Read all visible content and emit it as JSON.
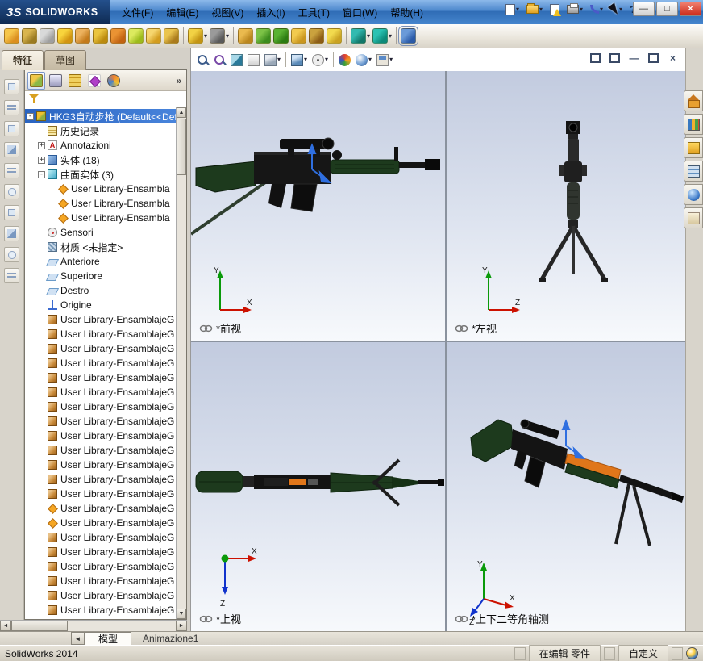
{
  "window": {
    "logo_prefix": "3S",
    "brand": "SOLIDWORKS",
    "buttons": {
      "minimize": "—",
      "maximize": "□",
      "close": "×"
    }
  },
  "menus": [
    "文件(F)",
    "编辑(E)",
    "视图(V)",
    "插入(I)",
    "工具(T)",
    "窗口(W)",
    "帮助(H)"
  ],
  "titlebar_tools": [
    {
      "name": "new-document-icon",
      "type": "page",
      "caret": "▾"
    },
    {
      "name": "open-document-icon",
      "type": "folder",
      "caret": "▾"
    },
    {
      "name": "save-document-icon",
      "type": "save"
    },
    {
      "name": "print-document-icon",
      "type": "printer",
      "caret": "▾"
    },
    {
      "name": "undo-icon",
      "type": "undo",
      "caret": "▾"
    },
    {
      "name": "select-cursor-icon",
      "type": "cursor",
      "caret": "▾"
    },
    {
      "name": "help-button",
      "type": "txt",
      "glyph": "?"
    }
  ],
  "toolbar_icons": [
    {
      "name": "folder-gold-icon",
      "c1": "#f6c64a",
      "c2": "#db8f1f"
    },
    {
      "name": "move-cross-icon",
      "c1": "#d9b54e",
      "c2": "#9b7b22"
    },
    {
      "name": "gray-box-icon",
      "c1": "#d9d9d9",
      "c2": "#9f9f9f"
    },
    {
      "name": "bell-icon",
      "c1": "#f8d43c",
      "c2": "#d29411"
    },
    {
      "name": "envelope-icon",
      "c1": "#ecb25e",
      "c2": "#c37a1b"
    },
    {
      "name": "crate-icon",
      "c1": "#eac43e",
      "c2": "#bb8a0e"
    },
    {
      "name": "notebook-icon",
      "c1": "#ea9333",
      "c2": "#c26312"
    },
    {
      "name": "page-green-icon",
      "c1": "#dcea5e",
      "c2": "#9cbb1c"
    },
    {
      "name": "folder-icon",
      "c1": "#f6d66e",
      "c2": "#d39c1e"
    },
    {
      "name": "wrench-gold-icon",
      "c1": "#eac44e",
      "c2": "#ab7b1c"
    },
    {
      "name": "separator",
      "type": "sep"
    },
    {
      "name": "palette-icon",
      "c1": "#f2d244",
      "c2": "#c39413",
      "caret": "▾"
    },
    {
      "name": "grid-menu-icon",
      "c1": "#9a9a9a",
      "c2": "#5a5a5a",
      "caret": "▾"
    },
    {
      "name": "separator",
      "type": "sep"
    },
    {
      "name": "block-gold-icon",
      "c1": "#eaba4e",
      "c2": "#ba861e"
    },
    {
      "name": "cube-green-icon",
      "c1": "#7cc246",
      "c2": "#3c8c1d"
    },
    {
      "name": "box-green-icon",
      "c1": "#5ab232",
      "c2": "#2c7c12"
    },
    {
      "name": "sphere-gold-icon",
      "c1": "#f2ca4e",
      "c2": "#ca961e"
    },
    {
      "name": "crate-brown-icon",
      "c1": "#caa23e",
      "c2": "#8c5c16"
    },
    {
      "name": "tag-yellow-icon",
      "c1": "#f2da4e",
      "c2": "#caa222"
    },
    {
      "name": "separator",
      "type": "sep"
    },
    {
      "name": "check-teal-icon",
      "c1": "#32bab0",
      "c2": "#12786a",
      "caret": "▾"
    },
    {
      "name": "spline-teal-icon",
      "c1": "#2ac2b2",
      "c2": "#0c8a7a",
      "caret": "▾"
    },
    {
      "name": "separator",
      "type": "sep"
    },
    {
      "name": "sketch-tool-icon",
      "c1": "#6a9ad8",
      "c2": "#2a5aa8",
      "type": "boxed"
    }
  ],
  "command_tabs": [
    {
      "label": "特征",
      "state": "active"
    },
    {
      "label": "草图",
      "state": "idle"
    }
  ],
  "left_tools": [
    {
      "name": "left-tool-icon-1",
      "type": "ls1"
    },
    {
      "name": "left-tool-icon-2",
      "type": "ls2"
    },
    {
      "name": "left-tool-icon-3",
      "type": "ls1"
    },
    {
      "name": "left-tool-icon-4",
      "type": "ls3"
    },
    {
      "name": "left-tool-icon-5",
      "type": "ls2"
    },
    {
      "name": "left-tool-icon-6",
      "type": "ls4"
    },
    {
      "name": "left-tool-icon-7",
      "type": "ls1"
    },
    {
      "name": "left-tool-icon-8",
      "type": "ls3"
    },
    {
      "name": "left-tool-icon-9",
      "type": "ls4"
    },
    {
      "name": "left-tool-icon-10",
      "type": "ls2"
    }
  ],
  "feature_panel": {
    "chevron": "»",
    "tabs": [
      {
        "name": "featuremanager-tab-icon",
        "type": "fmtree",
        "state": "active"
      },
      {
        "name": "propertymanager-tab-icon",
        "type": "fmclip",
        "state": "idle"
      },
      {
        "name": "configurationmanager-tab-icon",
        "type": "fmcfg",
        "state": "idle"
      },
      {
        "name": "dimxpertmanager-tab-icon",
        "type": "fmdim",
        "state": "idle"
      },
      {
        "name": "displaymanager-tab-icon",
        "type": "fmdisp",
        "state": "idle"
      }
    ]
  },
  "tree": {
    "root": {
      "exp": "-",
      "icon": "part",
      "label": "HKG3自动步枪 (Default<<Def"
    },
    "items": [
      {
        "icon": "history",
        "label": "历史记录"
      },
      {
        "exp": "+",
        "icon": "annotations",
        "label": "Annotazioni"
      },
      {
        "exp": "+",
        "icon": "solids",
        "label": "实体 (18)"
      },
      {
        "exp": "-",
        "icon": "surfaces",
        "label": "曲面实体 (3)"
      },
      {
        "icon": "diamond",
        "label": "User Library-Ensambla",
        "indent": 2
      },
      {
        "icon": "diamond",
        "label": "User Library-Ensambla",
        "indent": 2
      },
      {
        "icon": "diamond",
        "label": "User Library-Ensambla",
        "indent": 2
      },
      {
        "icon": "sensor",
        "label": "Sensori"
      },
      {
        "icon": "material",
        "label": "材质 <未指定>"
      },
      {
        "icon": "plane",
        "label": "Anteriore"
      },
      {
        "icon": "plane",
        "label": "Superiore"
      },
      {
        "icon": "plane",
        "label": "Destro"
      },
      {
        "icon": "origin",
        "label": "Origine"
      },
      {
        "icon": "cube",
        "label": "User Library-EnsamblajeG"
      },
      {
        "icon": "cube",
        "label": "User Library-EnsamblajeG"
      },
      {
        "icon": "cube",
        "label": "User Library-EnsamblajeG"
      },
      {
        "icon": "cube",
        "label": "User Library-EnsamblajeG"
      },
      {
        "icon": "cube",
        "label": "User Library-EnsamblajeG"
      },
      {
        "icon": "cube",
        "label": "User Library-EnsamblajeG"
      },
      {
        "icon": "cube",
        "label": "User Library-EnsamblajeG"
      },
      {
        "icon": "cube",
        "label": "User Library-EnsamblajeG"
      },
      {
        "icon": "cube",
        "label": "User Library-EnsamblajeG"
      },
      {
        "icon": "cube",
        "label": "User Library-EnsamblajeG"
      },
      {
        "icon": "cube",
        "label": "User Library-EnsamblajeG"
      },
      {
        "icon": "cube",
        "label": "User Library-EnsamblajeG"
      },
      {
        "icon": "cube",
        "label": "User Library-EnsamblajeG"
      },
      {
        "icon": "diamond",
        "label": "User Library-EnsamblajeG"
      },
      {
        "icon": "diamond",
        "label": "User Library-EnsamblajeG"
      },
      {
        "icon": "cube",
        "label": "User Library-EnsamblajeG"
      },
      {
        "icon": "cube",
        "label": "User Library-EnsamblajeG"
      },
      {
        "icon": "cube",
        "label": "User Library-EnsamblajeG"
      },
      {
        "icon": "cube",
        "label": "User Library-EnsamblajeG"
      },
      {
        "icon": "cube",
        "label": "User Library-EnsamblajeG"
      },
      {
        "icon": "cube",
        "label": "User Library-EnsamblajeG"
      }
    ]
  },
  "headsup_tools": [
    {
      "name": "zoom-fit-icon",
      "type": "vfit"
    },
    {
      "name": "zoom-area-icon",
      "type": "varea"
    },
    {
      "name": "section-view-icon",
      "type": "vsect"
    },
    {
      "name": "annotation-view-icon",
      "type": "vbook"
    },
    {
      "name": "view-orientation-icon",
      "type": "vcube",
      "caret": "▾"
    },
    {
      "name": "separator",
      "type": "vsep"
    },
    {
      "name": "display-style-icon",
      "type": "vcube2",
      "caret": "▾"
    },
    {
      "name": "hide-show-items-icon",
      "type": "vdof",
      "caret": "▾"
    },
    {
      "name": "separator",
      "type": "vsep"
    },
    {
      "name": "edit-appearance-icon",
      "type": "vball"
    },
    {
      "name": "apply-scene-icon",
      "type": "vball2",
      "caret": "▾"
    },
    {
      "name": "view-settings-icon",
      "type": "vpanel",
      "caret": "▾"
    }
  ],
  "doc_window_controls": [
    {
      "name": "doc-cascade-icon",
      "cls": "dwbox"
    },
    {
      "name": "doc-tile-icon",
      "cls": "dwbox"
    },
    {
      "name": "doc-minimize-button",
      "glyph": "—"
    },
    {
      "name": "doc-restore-button",
      "cls": "dwbox"
    },
    {
      "name": "doc-close-button",
      "glyph": "×"
    }
  ],
  "task_pane": [
    {
      "name": "solidworks-resources-icon",
      "type": "tphome"
    },
    {
      "name": "design-library-icon",
      "type": "tplib"
    },
    {
      "name": "file-explorer-icon",
      "type": "tpfolder"
    },
    {
      "name": "view-palette-icon",
      "type": "tppal"
    },
    {
      "name": "appearances-scenes-icon",
      "type": "tpglobe"
    },
    {
      "name": "custom-properties-icon",
      "type": "tppage"
    }
  ],
  "viewports": [
    {
      "label": "*前视",
      "axes": {
        "v": "Y",
        "h": "X"
      }
    },
    {
      "label": "*左视",
      "axes": {
        "v": "Y",
        "h": "Z"
      }
    },
    {
      "label": "*上视",
      "axes": {
        "h": "X",
        "d": "Z"
      }
    },
    {
      "label": "*上下二等角轴测",
      "axes": {
        "v": "Y",
        "h": "X",
        "d": "Z"
      }
    }
  ],
  "bottom_tabs": {
    "model": "模型",
    "animation": "Animazione1"
  },
  "scroll": {
    "up": "▲",
    "down": "▼",
    "left": "◄",
    "right": "►"
  },
  "status": {
    "app": "SolidWorks 2014",
    "mode": "在编辑 零件",
    "custom": "自定义"
  },
  "colors": {
    "titlebar_blue": "#4585cd",
    "selection_blue": "#2a63c0",
    "highlight_orange": "#e0761a",
    "model_green": "#1d3a1d",
    "model_black": "#141414",
    "viewport_gradient_top": "#c2cbdf",
    "viewport_gradient_bottom": "#f7f9fc"
  }
}
